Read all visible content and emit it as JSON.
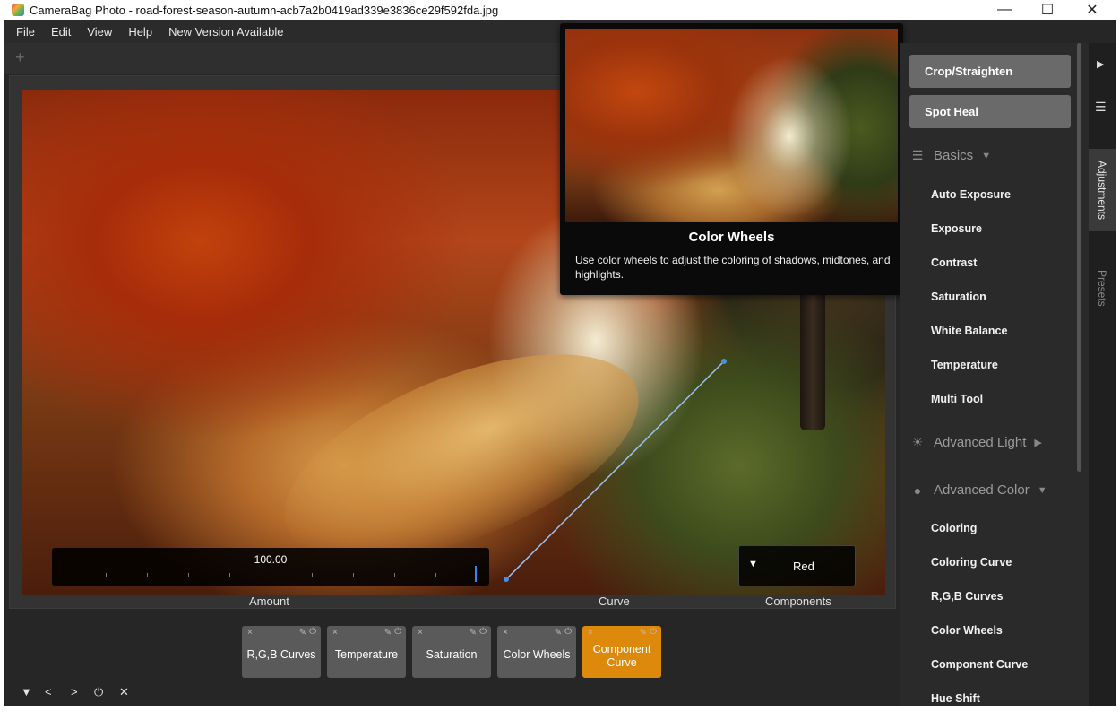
{
  "window": {
    "title": "CameraBag Photo - road-forest-season-autumn-acb7a2b0419ad339e3836ce29f592fda.jpg",
    "minimize": "—",
    "maximize": "☐",
    "close": "✕"
  },
  "menu": [
    "File",
    "Edit",
    "View",
    "Help",
    "New Version Available"
  ],
  "tabstrip": {
    "add": "+"
  },
  "tooltip": {
    "title": "Color Wheels",
    "description": "Use color wheels to adjust the coloring of shadows, midtones, and highlights."
  },
  "controls": {
    "amount_value": "100.00",
    "amount_label": "Amount",
    "curve_label": "Curve",
    "components_label": "Components",
    "components_value": "Red",
    "amount_fraction": 1.0
  },
  "sidebar": {
    "crop_button": "Crop/Straighten",
    "spotheal_button": "Spot Heal",
    "basics": {
      "label": "Basics",
      "arrow": "▼",
      "icon": "sliders-icon"
    },
    "basics_items": [
      "Auto Exposure",
      "Exposure",
      "Contrast",
      "Saturation",
      "White Balance",
      "Temperature",
      "Multi Tool"
    ],
    "advanced_light": {
      "label": "Advanced Light",
      "arrow": "▶",
      "icon": "sun-icon"
    },
    "advanced_color": {
      "label": "Advanced Color",
      "arrow": "▼",
      "icon": "palette-icon"
    },
    "advanced_color_items": [
      "Coloring",
      "Coloring Curve",
      "R,G,B Curves",
      "Color Wheels",
      "Component Curve",
      "Hue Shift"
    ]
  },
  "vtabs": {
    "adjustments": "Adjustments",
    "presets": "Presets"
  },
  "bottom": {
    "chips": [
      "R,G,B Curves",
      "Temperature",
      "Saturation",
      "Color Wheels",
      "Component Curve"
    ],
    "chip_close": "×",
    "chip_pin": "✎",
    "chip_power": "⏻",
    "active_index": 4,
    "controls": [
      "▼",
      "<",
      ">",
      "⏻",
      "✕"
    ]
  },
  "colors": {
    "accent": "#dd8a0c",
    "panel": "#2a2a2a",
    "highlight": "#3b82f6"
  }
}
